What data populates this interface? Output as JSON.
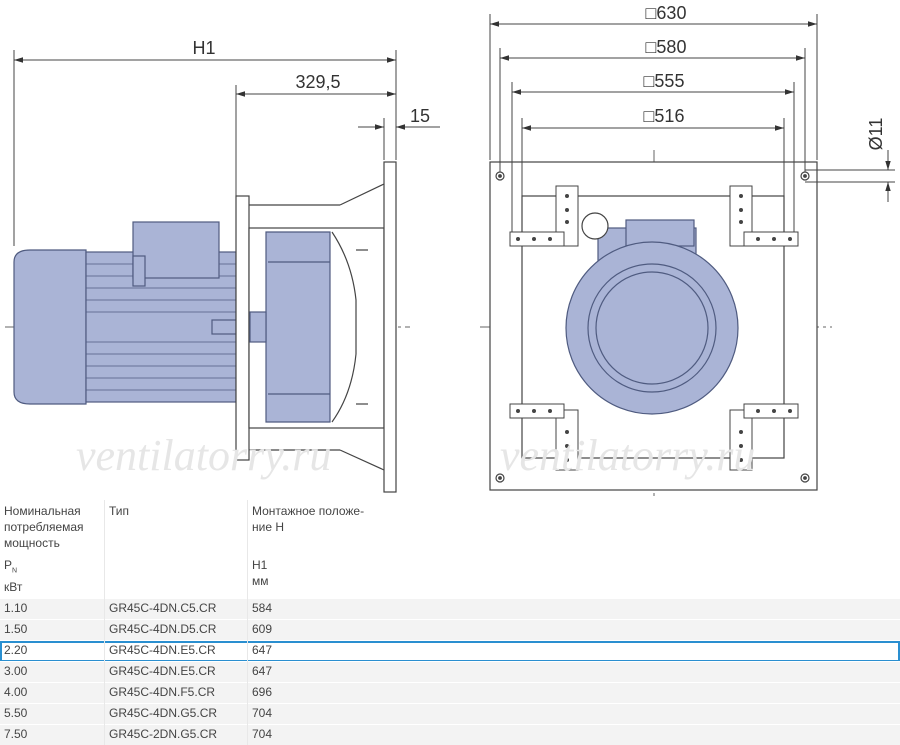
{
  "drawing": {
    "dims": {
      "h1": "H1",
      "d329": "329,5",
      "d15": "15",
      "s630": "□630",
      "s580": "□580",
      "s555": "□555",
      "s516": "□516",
      "d11": "Ø11"
    },
    "watermark": "ventilatorry.ru",
    "colors": {
      "body": "#aab4d6",
      "stroke": "#4f5b80",
      "line": "#444444"
    }
  },
  "table": {
    "headers": {
      "col1": [
        "Номинальная",
        "потребляемая",
        "мощность"
      ],
      "col1_symbol": "P",
      "col1_sub": "N",
      "col1_unit": "кВт",
      "col2": "Тип",
      "col3": [
        "Монтажное положе-",
        "ние H"
      ],
      "col3_symbol": "H1",
      "col3_unit": "мм"
    },
    "rows": [
      {
        "power": "1.10",
        "type": "GR45C-4DN.C5.CR",
        "h1": "584",
        "highlighted": false
      },
      {
        "power": "1.50",
        "type": "GR45C-4DN.D5.CR",
        "h1": "609",
        "highlighted": false
      },
      {
        "power": "2.20",
        "type": "GR45C-4DN.E5.CR",
        "h1": "647",
        "highlighted": true
      },
      {
        "power": "3.00",
        "type": "GR45C-4DN.E5.CR",
        "h1": "647",
        "highlighted": false
      },
      {
        "power": "4.00",
        "type": "GR45C-4DN.F5.CR",
        "h1": "696",
        "highlighted": false
      },
      {
        "power": "5.50",
        "type": "GR45C-4DN.G5.CR",
        "h1": "704",
        "highlighted": false
      },
      {
        "power": "7.50",
        "type": "GR45C-2DN.G5.CR",
        "h1": "704",
        "highlighted": false
      }
    ]
  }
}
